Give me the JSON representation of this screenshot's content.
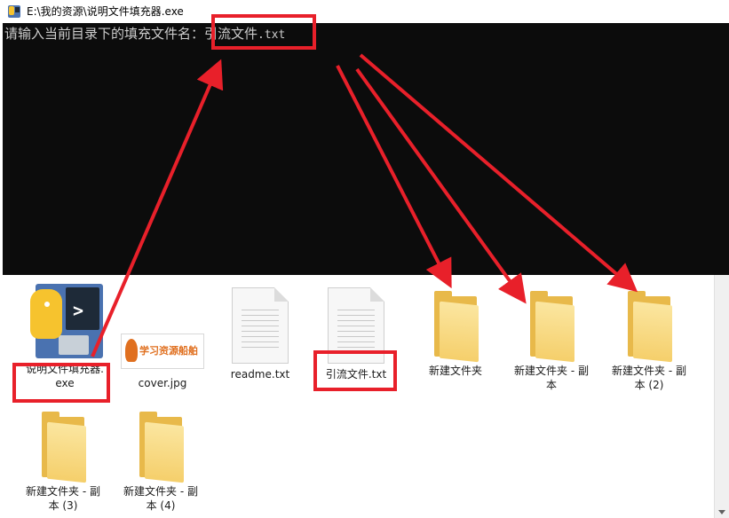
{
  "window": {
    "title": "E:\\我的资源\\说明文件填充器.exe"
  },
  "console": {
    "prompt": "请输入当前目录下的填充文件名：",
    "input_name": "引流文件",
    "input_ext": ".txt"
  },
  "files": [
    {
      "name": "说明文件填充器.exe",
      "label_line1": "说明文件填充器.",
      "label_line2": "exe",
      "icon": "python-exe-icon"
    },
    {
      "name": "cover.jpg",
      "icon": "image-thumbnail",
      "thumb_text": "学习资源船舶"
    },
    {
      "name": "readme.txt",
      "icon": "text-document-icon"
    },
    {
      "name": "引流文件.txt",
      "icon": "text-document-icon"
    },
    {
      "name": "新建文件夹",
      "icon": "folder-icon"
    },
    {
      "name": "新建文件夹 - 副本",
      "label_line1": "新建文件夹 - 副",
      "label_line2": "本",
      "icon": "folder-icon"
    },
    {
      "name": "新建文件夹 - 副本 (2)",
      "label_line1": "新建文件夹 - 副",
      "label_line2": "本 (2)",
      "icon": "folder-icon"
    },
    {
      "name": "新建文件夹 - 副本 (3)",
      "label_line1": "新建文件夹 - 副",
      "label_line2": "本 (3)",
      "icon": "folder-icon"
    },
    {
      "name": "新建文件夹 - 副本 (4)",
      "label_line1": "新建文件夹 - 副",
      "label_line2": "本 (4)",
      "icon": "folder-icon"
    }
  ],
  "colors": {
    "highlight": "#e8202a",
    "console_bg": "#0c0c0c",
    "console_text": "#cccccc",
    "folder": "#f5cf6b"
  }
}
